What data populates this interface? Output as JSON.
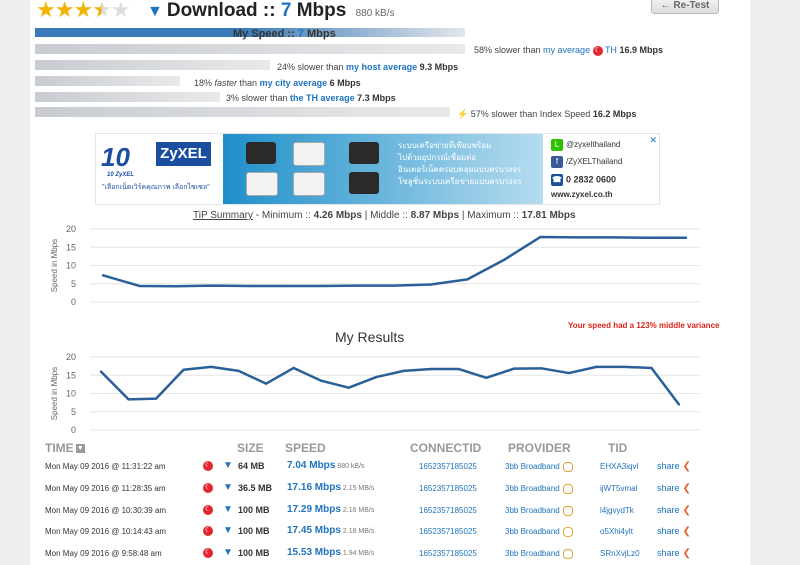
{
  "rating": {
    "stars": 3.5,
    "max": 5
  },
  "header": {
    "title_label": "Download ::",
    "speed_value": "7",
    "speed_unit": "Mbps",
    "kbs": "880 kB/s",
    "retest_label": "← Re-Test"
  },
  "my_speed": {
    "label": "My Speed ::",
    "value": "7",
    "unit": "Mbps"
  },
  "comparisons": [
    {
      "pre": "58% slower than ",
      "link": "my average",
      "extra": "TH",
      "value": "16.9 Mbps",
      "fill": 0.53
    },
    {
      "pre": "24% slower than ",
      "link": "my host average",
      "extra": "",
      "value": "9.3 Mbps",
      "fill": 0.32
    },
    {
      "pre": "18% ",
      "italic": "faster",
      "post": " than ",
      "link": "my city average",
      "value": "6 Mbps",
      "fill": 0.18
    },
    {
      "pre": "3% slower than ",
      "link": "the TH average",
      "extra": "",
      "value": "7.3 Mbps",
      "fill": 0.25
    },
    {
      "pre": "57% slower than Index Speed ",
      "link": "",
      "extra": "",
      "value": "16.2 Mbps",
      "fill": 0.52
    }
  ],
  "ad": {
    "brand1": "10",
    "brand1_small": "10 ZyXEL",
    "brand2": "ZyXEL",
    "slogan": "\"เลือกเน็ตเวิร์คคุณภาพ เลือกไซเซล\"",
    "thai_lines": [
      "ระบบเครือข่ายที่เพียบพร้อม",
      "ไปด้วยอุปกรณ์เชื่อมต่อ",
      "อินเตอร์เน็ตครอบคลุมแบบครบวงจร",
      "โซลูชั่นระบบเครือข่ายแบบครบวงจร"
    ],
    "line_id": "@zyxelthailand",
    "facebook": "/ZyXELThailand",
    "phone": "0 2832 0600",
    "website": "www.zyxel.co.th",
    "close": "✕"
  },
  "tip_summary": {
    "label": "TiP Summary",
    "min_label": "- Minimum :: ",
    "min_value": "4.26 Mbps",
    "mid_label": "| Middle :: ",
    "mid_value": "8.87 Mbps",
    "max_label": "| Maximum :: ",
    "max_value": "17.81 Mbps"
  },
  "chart_data": [
    {
      "type": "line",
      "title": "",
      "ylabel": "Speed in Mbps",
      "ylim": [
        0,
        20
      ],
      "yticks": [
        0,
        5,
        10,
        15,
        20
      ],
      "grid": true,
      "color": "#2b5f9a",
      "series": [
        {
          "values": [
            7.3,
            4.4,
            4.3,
            4.5,
            4.4,
            4.4,
            4.4,
            4.5,
            4.5,
            4.8,
            6.2,
            11.5,
            17.8,
            17.7,
            17.7,
            17.6,
            17.6
          ]
        }
      ]
    },
    {
      "type": "line",
      "title": "My Results",
      "ylabel": "Speed in Mbps",
      "ylim": [
        0,
        20
      ],
      "yticks": [
        0,
        5,
        10,
        15,
        20
      ],
      "grid": true,
      "color": "#2b5f9a",
      "series": [
        {
          "values": [
            16,
            8.4,
            8.6,
            16.5,
            17.3,
            16.2,
            12.7,
            17,
            13.5,
            11.6,
            14.5,
            16.2,
            16.7,
            16.7,
            14.3,
            16.8,
            16.9,
            15.6,
            17.3,
            17.3,
            17,
            7
          ]
        }
      ]
    }
  ],
  "variance_text": "Your speed had a 123% middle variance",
  "table": {
    "headers": {
      "time": "TIME",
      "size": "SIZE",
      "speed": "SPEED",
      "connectid": "CONNECTID",
      "provider": "PROVIDER",
      "tid": "TID"
    },
    "rows": [
      {
        "time": "Mon May 09 2016 @ 11:31:22 am",
        "size": "64 MB",
        "speed": "7.04 Mbps",
        "rate": "880 kB/s",
        "connectid": "1652357185025",
        "provider": "3bb Broadband",
        "tid": "EHXA3iqvl",
        "share": "share"
      },
      {
        "time": "Mon May 09 2016 @ 11:28:35 am",
        "size": "36.5 MB",
        "speed": "17.16 Mbps",
        "rate": "2.15 MB/s",
        "connectid": "1652357185025",
        "provider": "3bb Broadband",
        "tid": "ijWT5vmal",
        "share": "share"
      },
      {
        "time": "Mon May 09 2016 @ 10:30:39 am",
        "size": "100 MB",
        "speed": "17.29 Mbps",
        "rate": "2.16 MB/s",
        "connectid": "1652357185025",
        "provider": "3bb Broadband",
        "tid": "l4jgvydTk",
        "share": "share"
      },
      {
        "time": "Mon May 09 2016 @ 10:14:43 am",
        "size": "100 MB",
        "speed": "17.45 Mbps",
        "rate": "2.18 MB/s",
        "connectid": "1652357185025",
        "provider": "3bb Broadband",
        "tid": "o5Xhi4ylt",
        "share": "share"
      },
      {
        "time": "Mon May 09 2016 @ 9:58:48 am",
        "size": "100 MB",
        "speed": "15.53 Mbps",
        "rate": "1.94 MB/s",
        "connectid": "1652357185025",
        "provider": "3bb Broadband",
        "tid": "SRnXvjLz0",
        "share": "share"
      }
    ]
  }
}
